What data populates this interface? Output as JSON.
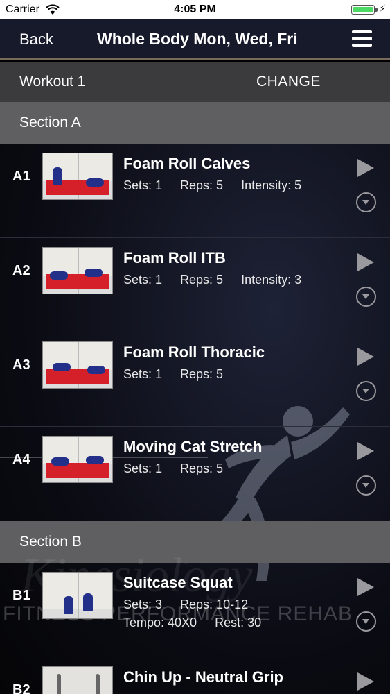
{
  "status_bar": {
    "carrier": "Carrier",
    "time": "4:05 PM"
  },
  "navbar": {
    "back_label": "Back",
    "title": "Whole Body Mon, Wed, Fri"
  },
  "workout_bar": {
    "workout_label": "Workout 1",
    "change_label": "CHANGE"
  },
  "sections": [
    {
      "label": "Section A",
      "exercises": [
        {
          "code": "A1",
          "name": "Foam Roll Calves",
          "sets": "Sets: 1",
          "reps": "Reps: 5",
          "intensity": "Intensity: 5"
        },
        {
          "code": "A2",
          "name": "Foam Roll ITB",
          "sets": "Sets: 1",
          "reps": "Reps: 5",
          "intensity": "Intensity: 3"
        },
        {
          "code": "A3",
          "name": "Foam Roll Thoracic",
          "sets": "Sets: 1",
          "reps": "Reps: 5"
        },
        {
          "code": "A4",
          "name": "Moving Cat Stretch",
          "sets": "Sets: 1",
          "reps": "Reps: 5"
        }
      ]
    },
    {
      "label": "Section B",
      "exercises": [
        {
          "code": "B1",
          "name": "Suitcase Squat",
          "sets": "Sets: 3",
          "reps": "Reps: 10-12",
          "tempo": "Tempo: 40X0",
          "rest": "Rest: 30"
        },
        {
          "code": "B2",
          "name": "Chin Up - Neutral Grip"
        }
      ]
    }
  ],
  "watermark": {
    "brand_script": "Kinesiology",
    "tagline": "FITNESS PERFORMANCE REHAB"
  },
  "colors": {
    "navbar": "#161a2b",
    "accent_line": "#7a6a5a",
    "workout_bar": "#3b3b3e",
    "section_header": "#5f5f61",
    "mat_red": "#d5202a",
    "icon_gray": "#9a9a9e"
  },
  "icons": {
    "menu": "hamburger-icon",
    "play": "play-icon",
    "expand": "chevron-down-circle-icon",
    "wifi": "wifi-icon",
    "battery": "battery-icon"
  }
}
